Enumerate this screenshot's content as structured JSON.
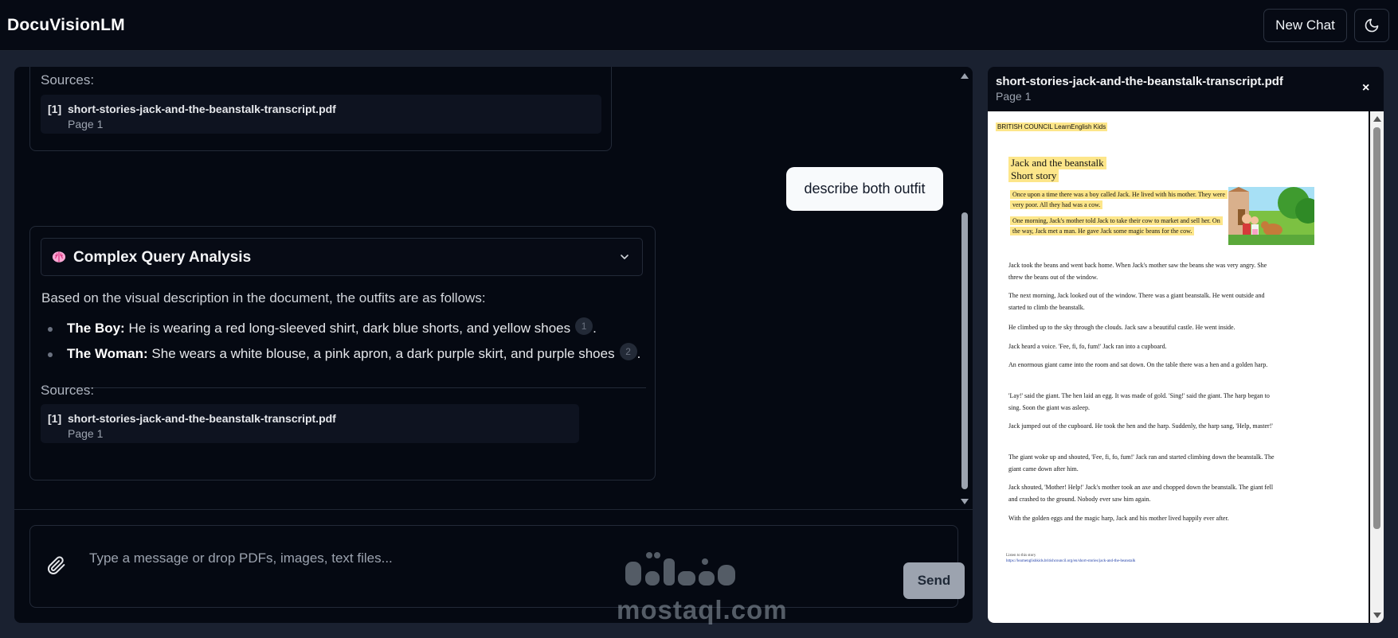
{
  "app": {
    "title": "DocuVisionLM"
  },
  "header": {
    "new_chat_label": "New Chat",
    "theme_icon": "moon-icon"
  },
  "chat": {
    "prev_sources": {
      "label": "Sources:",
      "items": [
        {
          "num": "[1]",
          "file": "short-stories-jack-and-the-beanstalk-transcript.pdf",
          "page": "Page 1"
        }
      ]
    },
    "user_message": "describe both outfit",
    "assistant": {
      "header_icon": "brain-icon",
      "header_title": "Complex Query Analysis",
      "intro": "Based on the visual description in the document, the outfits are as follows:",
      "items": [
        {
          "label": "The Boy:",
          "text": " He is wearing a red long-sleeved shirt, dark blue shorts, and yellow shoes",
          "cite": "1",
          "end": "."
        },
        {
          "label": "The Woman:",
          "text": " She wears a white blouse, a pink apron, a dark purple skirt, and purple shoes",
          "cite": "2",
          "end": "."
        }
      ],
      "sources_label": "Sources:",
      "sources": [
        {
          "num": "[1]",
          "file": "short-stories-jack-and-the-beanstalk-transcript.pdf",
          "page": "Page 1"
        }
      ]
    }
  },
  "composer": {
    "placeholder": "Type a message or drop PDFs, images, text files...",
    "attach_icon": "paperclip-icon",
    "send_label": "Send"
  },
  "watermark": {
    "text": "mostaql.com"
  },
  "preview": {
    "file_name": "short-stories-jack-and-the-beanstalk-transcript.pdf",
    "page_label": "Page 1",
    "close_label": "×",
    "pdf": {
      "brand": "BRITISH COUNCIL LearnEnglish Kids",
      "title_line1": "Jack and the beanstalk",
      "title_line2": "Short story",
      "hl_para1": "Once upon a time there was a boy called Jack. He lived with his mother. They were very poor. All they had was a cow.",
      "hl_para2": "One morning, Jack's mother told Jack to take their cow to market and sell her. On the way, Jack met a man. He gave Jack some magic beans for the cow.",
      "paragraphs": [
        "Jack took the beans and went back home. When Jack's mother saw the beans she was very angry. She threw the beans out of the window.",
        "The next morning, Jack looked out of the window. There was a giant beanstalk. He went outside and started to climb the beanstalk.",
        "He climbed up to the sky through the clouds. Jack saw a beautiful castle. He went inside.",
        "Jack heard a voice. 'Fee, fi, fo, fum!' Jack ran into a cupboard.",
        "An enormous giant came into the room and sat down. On the table there was a hen and a golden harp.",
        "'Lay!' said the giant. The hen laid an egg. It was made of gold. 'Sing!' said the giant. The harp began to sing. Soon the giant was asleep.",
        "Jack jumped out of the cupboard. He took the hen and the harp. Suddenly, the harp sang, 'Help, master!'",
        "The giant woke up and shouted, 'Fee, fi, fo, fum!' Jack ran and started climbing down the beanstalk. The giant came down after him.",
        "Jack shouted, 'Mother! Help!' Jack's mother took an axe and chopped down the beanstalk. The giant fell and crashed to the ground. Nobody ever saw him again.",
        "With the golden eggs and the magic harp, Jack and his mother lived happily ever after."
      ],
      "footer_label": "Listen to this story",
      "footer_link": "https://learnenglishkids.britishcouncil.org/en/short-stories/jack-and-the-beanstalk"
    }
  }
}
